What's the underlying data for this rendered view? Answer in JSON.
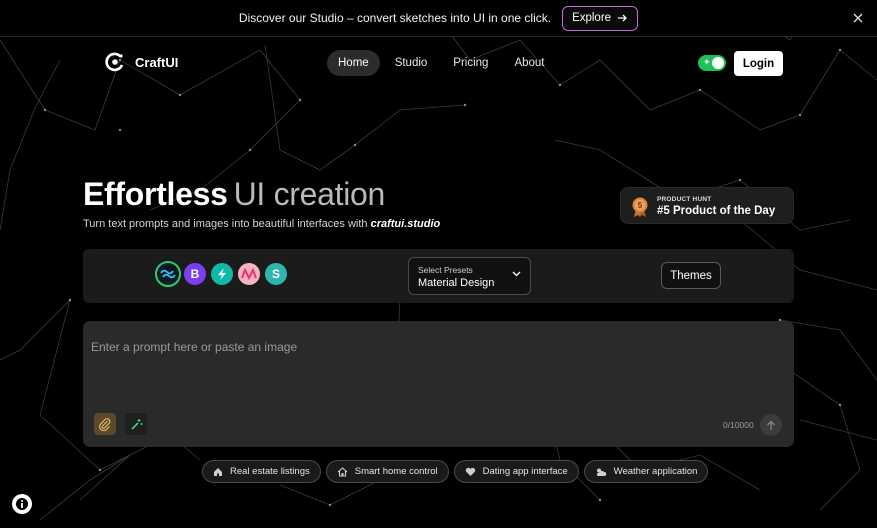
{
  "banner": {
    "text": "Discover our Studio – convert sketches into UI in one click.",
    "explore_label": "Explore",
    "close_icon": "close-icon"
  },
  "nav": {
    "logo_text": "CraftUI",
    "links": [
      "Home",
      "Studio",
      "Pricing",
      "About"
    ],
    "active_link": "Home",
    "login_label": "Login",
    "toggle_on": true,
    "toggle_color": "#1fbf5a"
  },
  "hero": {
    "title_main": "Effortless",
    "title_accent": "UI creation",
    "subtitle": "Turn text prompts and images into beautiful interfaces with ",
    "subtitle_brand": "craftui.studio"
  },
  "product_hunt": {
    "label": "PRODUCT HUNT",
    "medal_number": "5",
    "title": "#5 Product of the Day"
  },
  "toolbar": {
    "libraries": [
      {
        "name": "tailwind-icon",
        "glyph": ""
      },
      {
        "name": "bootstrap-icon",
        "glyph": "B"
      },
      {
        "name": "chakra-icon",
        "glyph": ""
      },
      {
        "name": "material-ui-icon",
        "glyph": ""
      },
      {
        "name": "styled-icon",
        "glyph": "S"
      }
    ],
    "preset_label": "Select Presets",
    "preset_value": "Material Design",
    "themes_label": "Themes"
  },
  "prompt": {
    "placeholder": "Enter a prompt here or paste an image",
    "value": "",
    "counter": "0/10000"
  },
  "suggestions": [
    {
      "label": "Real estate listings",
      "icon": "home-icon"
    },
    {
      "label": "Smart home control",
      "icon": "house-icon"
    },
    {
      "label": "Dating app interface",
      "icon": "heart-icon"
    },
    {
      "label": "Weather application",
      "icon": "weather-icon"
    }
  ]
}
